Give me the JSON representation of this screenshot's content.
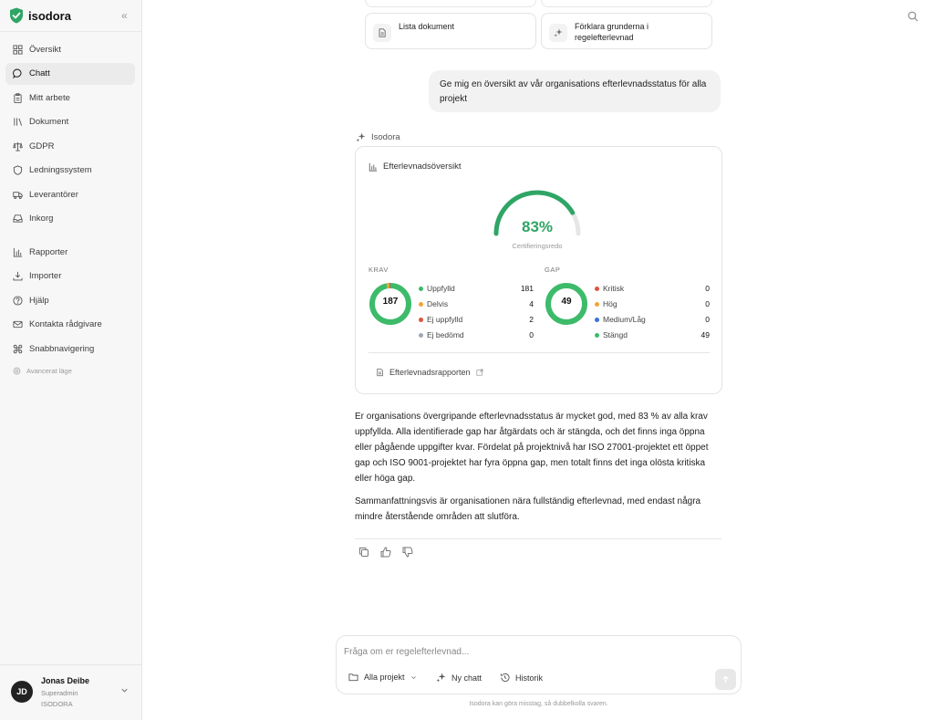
{
  "brand": {
    "name": "isodora",
    "accent": "#2fa565"
  },
  "sidebar": {
    "items": [
      {
        "label": "Översikt",
        "icon": "grid-icon"
      },
      {
        "label": "Chatt",
        "icon": "chat-icon"
      },
      {
        "label": "Mitt arbete",
        "icon": "clipboard-icon"
      },
      {
        "label": "Dokument",
        "icon": "library-icon"
      },
      {
        "label": "GDPR",
        "icon": "scale-icon"
      },
      {
        "label": "Ledningssystem",
        "icon": "shield-icon"
      },
      {
        "label": "Leverantörer",
        "icon": "truck-icon"
      },
      {
        "label": "Inkorg",
        "icon": "inbox-icon"
      },
      {
        "label": "Rapporter",
        "icon": "bar-chart-icon"
      },
      {
        "label": "Importer",
        "icon": "download-icon"
      },
      {
        "label": "Hjälp",
        "icon": "help-icon"
      },
      {
        "label": "Kontakta rådgivare",
        "icon": "mail-icon"
      },
      {
        "label": "Snabbnavigering",
        "icon": "command-icon"
      }
    ],
    "active": "Chatt",
    "advanced": "Avancerat läge"
  },
  "user": {
    "initials": "JD",
    "name": "Jonas Deibe",
    "role": "Superadmin",
    "org": "ISODORA"
  },
  "suggestions": [
    {
      "label": "Lista dokument",
      "icon": "document-icon"
    },
    {
      "label": "Förklara grunderna i regelefterlevnad",
      "icon": "sparkle-icon"
    }
  ],
  "user_message": "Ge mig en översikt av vår organisations efterlevnadsstatus för alla projekt",
  "assistant": {
    "name": "Isodora",
    "card": {
      "title": "Efterlevnadsöversikt",
      "gauge": {
        "value": "83%",
        "percent": 83,
        "label": "Certifieringsredo"
      },
      "krav": {
        "label": "KRAV",
        "total": "187",
        "rows": [
          {
            "label": "Uppfylld",
            "value": "181",
            "color": "#3dbb6a"
          },
          {
            "label": "Delvis",
            "value": "4",
            "color": "#f0a43a"
          },
          {
            "label": "Ej uppfylld",
            "value": "2",
            "color": "#e0533d"
          },
          {
            "label": "Ej bedömd",
            "value": "0",
            "color": "#a0a8b8"
          }
        ]
      },
      "gap": {
        "label": "GAP",
        "total": "49",
        "rows": [
          {
            "label": "Kritisk",
            "value": "0",
            "color": "#e0533d"
          },
          {
            "label": "Hög",
            "value": "0",
            "color": "#f0a43a"
          },
          {
            "label": "Medium/Låg",
            "value": "0",
            "color": "#3a6fd8"
          },
          {
            "label": "Stängd",
            "value": "49",
            "color": "#3dbb6a"
          }
        ]
      },
      "report_link": "Efterlevnadsrapporten"
    },
    "paragraphs": [
      "Er organisations övergripande efterlevnadsstatus är mycket god, med 83 % av alla krav uppfyllda. Alla identifierade gap har åtgärdats och är stängda, och det finns inga öppna eller pågående uppgifter kvar. Fördelat på projektnivå har ISO 27001-projektet ett öppet gap och ISO 9001-projektet har fyra öppna gap, men totalt finns det inga olösta kritiska eller höga gap.",
      "Sammanfattningsvis är organisationen nära fullständig efterlevnad, med endast några mindre återstående områden att slutföra."
    ]
  },
  "composer": {
    "placeholder": "Fråga om er regelefterlevnad...",
    "projects": "Alla projekt",
    "new_chat": "Ny chatt",
    "history": "Historik"
  },
  "disclaimer": "Isodora kan göra misstag, så dubbelkolla svaren."
}
